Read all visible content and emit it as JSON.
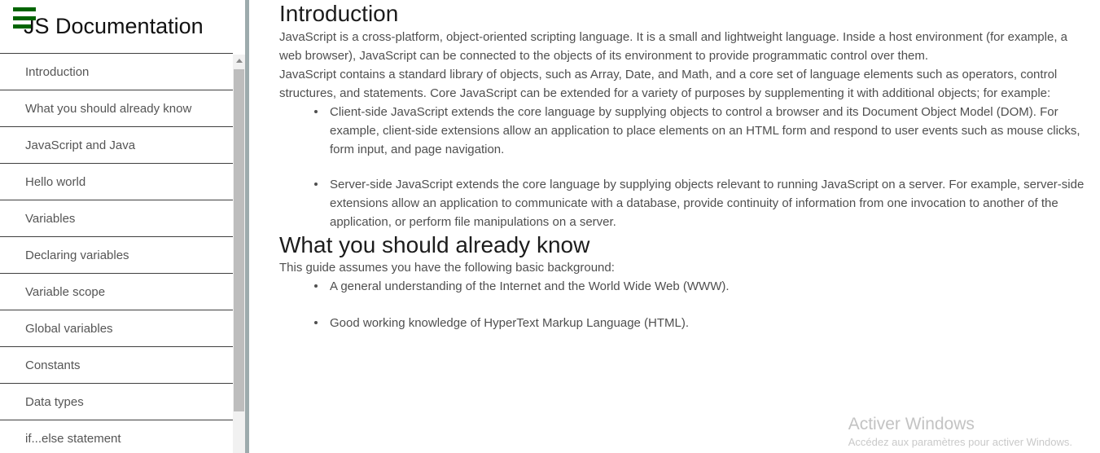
{
  "sidebar": {
    "menu_icon": "hamburger-menu-icon",
    "title": "JS Documentation",
    "items": [
      {
        "label": "Introduction"
      },
      {
        "label": "What you should already know"
      },
      {
        "label": "JavaScript and Java"
      },
      {
        "label": "Hello world"
      },
      {
        "label": "Variables"
      },
      {
        "label": "Declaring variables"
      },
      {
        "label": "Variable scope"
      },
      {
        "label": "Global variables"
      },
      {
        "label": "Constants"
      },
      {
        "label": "Data types"
      },
      {
        "label": "if...else statement"
      }
    ],
    "scrollbar": {
      "up_arrow": "scroll-up-arrow"
    }
  },
  "main": {
    "sections": [
      {
        "heading": "Introduction",
        "paragraphs": [
          "JavaScript is a cross-platform, object-oriented scripting language. It is a small and lightweight language. Inside a host environment (for example, a web browser), JavaScript can be connected to the objects of its environment to provide programmatic control over them.",
          "JavaScript contains a standard library of objects, such as Array, Date, and Math, and a core set of language elements such as operators, control structures, and statements. Core JavaScript can be extended for a variety of purposes by supplementing it with additional objects; for example:"
        ],
        "bullets": [
          "Client-side JavaScript extends the core language by supplying objects to control a browser and its Document Object Model (DOM). For example, client-side extensions allow an application to place elements on an HTML form and respond to user events such as mouse clicks, form input, and page navigation.",
          "Server-side JavaScript extends the core language by supplying objects relevant to running JavaScript on a server. For example, server-side extensions allow an application to communicate with a database, provide continuity of information from one invocation to another of the application, or perform file manipulations on a server."
        ]
      },
      {
        "heading": "What you should already know",
        "paragraphs": [
          "This guide assumes you have the following basic background:"
        ],
        "bullets": [
          "A general understanding of the Internet and the World Wide Web (WWW).",
          "Good working knowledge of HyperText Markup Language (HTML)."
        ]
      }
    ]
  },
  "watermark": {
    "title": "Activer Windows",
    "subtitle": "Accédez aux paramètres pour activer Windows."
  },
  "colors": {
    "menu_icon_green": "#006400",
    "divider_gray": "#9dabad",
    "scroll_thumb": "#bdbdbd",
    "body_text": "#4f4f4f",
    "heading_text": "#1c1c1c"
  }
}
